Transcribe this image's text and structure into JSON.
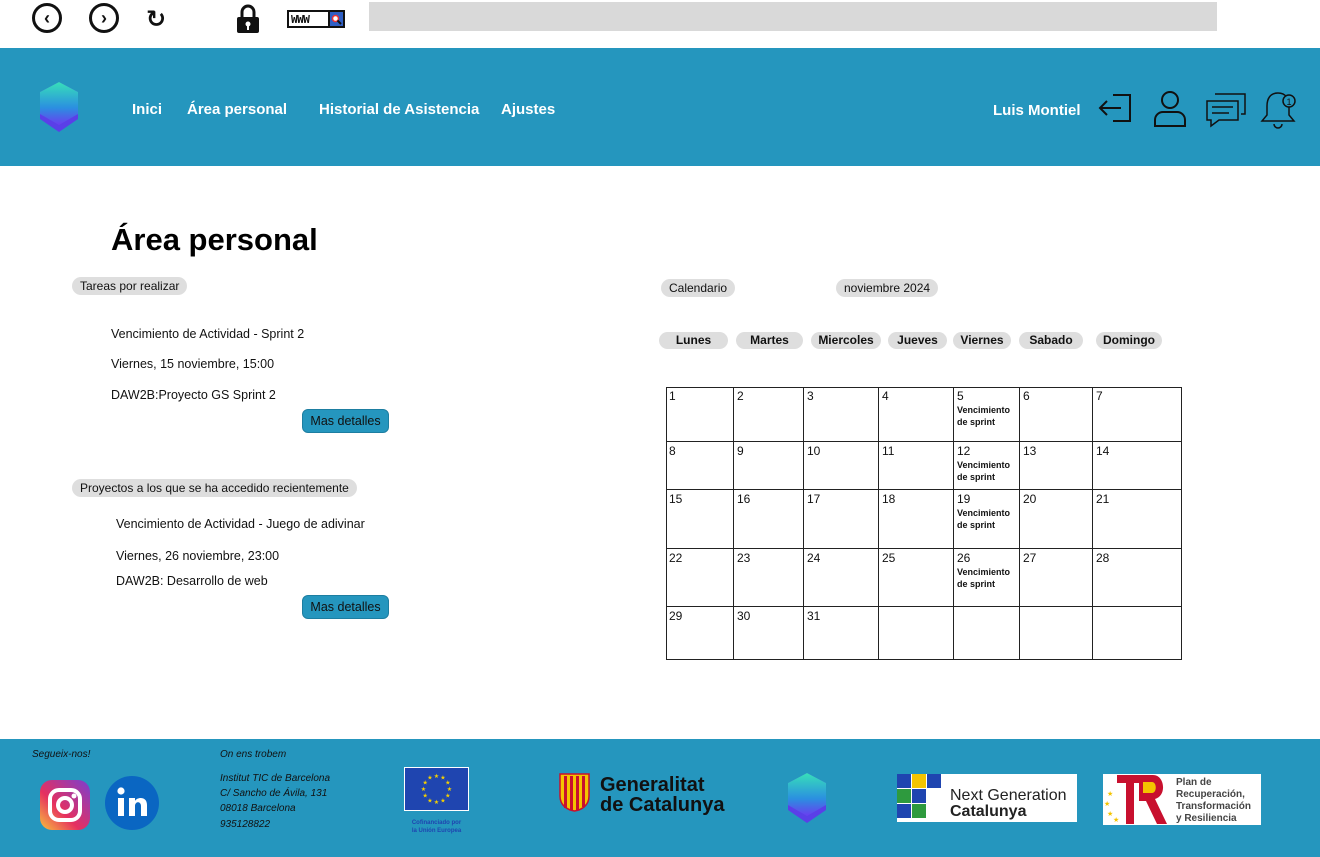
{
  "browser": {
    "back_icon": "back-arrow-icon",
    "forward_icon": "forward-arrow-icon",
    "reload_icon": "reload-icon",
    "lock_icon": "lock-icon",
    "www_label": "WWW",
    "url": ""
  },
  "header": {
    "nav": [
      "Inici",
      "Área personal",
      "Historial de Asistencia",
      "Ajustes"
    ],
    "user_name": "Luis Montiel",
    "notification_count": "1",
    "brand_color": "#2596be"
  },
  "main": {
    "title": "Área personal",
    "tasks": {
      "label": "Tareas por realizar",
      "line1": "Vencimiento de Actividad - Sprint 2",
      "line2": "Viernes, 15 noviembre, 15:00",
      "line3": "DAW2B:Proyecto GS Sprint 2",
      "button": "Mas detalles"
    },
    "recent": {
      "label": "Proyectos a los que se ha accedido recientemente",
      "line1": "Vencimiento de Actividad - Juego de adivinar",
      "line2": "Viernes, 26 noviembre, 23:00",
      "line3": "DAW2B: Desarrollo de web",
      "button": "Mas detalles"
    },
    "calendar": {
      "label": "Calendario",
      "month": "noviembre 2024",
      "weekdays": [
        "Lunes",
        "Martes",
        "Miercoles",
        "Jueves",
        "Viernes",
        "Sabado",
        "Domingo"
      ],
      "weeks": [
        [
          "1",
          "2",
          "3",
          "4",
          "5",
          "6",
          "7"
        ],
        [
          "8",
          "9",
          "10",
          "11",
          "12",
          "13",
          "14"
        ],
        [
          "15",
          "16",
          "17",
          "18",
          "19",
          "20",
          "21"
        ],
        [
          "22",
          "23",
          "24",
          "25",
          "26",
          "27",
          "28"
        ],
        [
          "29",
          "30",
          "31",
          "",
          "",
          "",
          ""
        ]
      ],
      "events": [
        [
          "",
          "",
          "",
          "",
          "Vencimiento de sprint",
          "",
          ""
        ],
        [
          "",
          "",
          "",
          "",
          "Vencimiento de sprint",
          "",
          ""
        ],
        [
          "",
          "",
          "",
          "",
          "Vencimiento de sprint",
          "",
          ""
        ],
        [
          "",
          "",
          "",
          "",
          "Vencimiento de sprint",
          "",
          ""
        ],
        [
          "",
          "",
          "",
          "",
          "",
          "",
          ""
        ]
      ]
    }
  },
  "footer": {
    "follow": "Segueix-nos!",
    "find_us": "On ens trobem",
    "address": [
      "Institut TIC de Barcelona",
      "C/ Sancho de Ávila, 131",
      "08018 Barcelona",
      "935128822"
    ],
    "eu_caption": [
      "Cofinanciado por",
      "la Unión Europea"
    ],
    "generalitat": [
      "Generalitat",
      "de Catalunya"
    ],
    "next_gen": [
      "Next Generation",
      "Catalunya"
    ],
    "recovery": [
      "Plan de",
      "Recuperación,",
      "Transformación",
      "y Resiliencia"
    ]
  }
}
